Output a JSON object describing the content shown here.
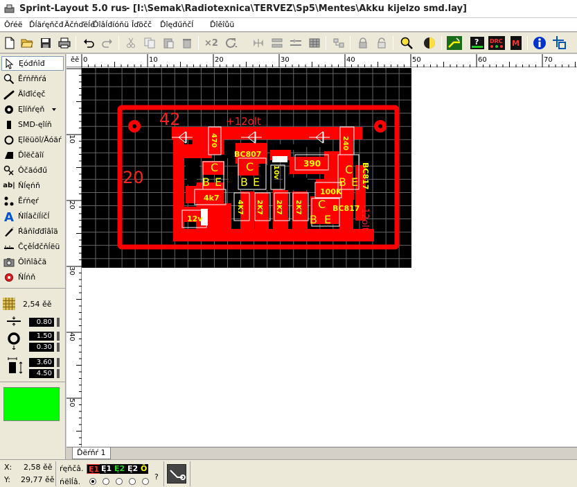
{
  "window": {
    "app_title": "Sprint-Layout 5.0 rus",
    "file_path": "- [I:\\Semak\\Radiotexnica\\TERVEZ\\Sp5\\Mentes\\Akku kijelzo smd.lay]"
  },
  "menu": [
    "Ôŕéë",
    "Ďĺäŕęňčđ",
    "Äčńďëĺé",
    "Ďîâĺđíóňü",
    "Îďöčč",
    "Ďîęđűňčĺ",
    "Ďîěîůü"
  ],
  "toolbar": {
    "icons": [
      "new-icon",
      "open-icon",
      "save-icon",
      "print-icon",
      "undo-icon",
      "redo-icon",
      "cut-icon",
      "copy-icon",
      "paste-icon",
      "delete-icon",
      "duplicate-x2-icon",
      "rotate-icon",
      "mirror-h-icon",
      "mirror-v-icon",
      "align-icon",
      "group-icon",
      "ungroup-icon",
      "lock-icon",
      "unlock-icon",
      "zoom-icon",
      "view-toggle-icon",
      "autorouter-icon",
      "help-components-icon",
      "drc-icon",
      "macro-icon",
      "info-icon",
      "crosshair-icon"
    ],
    "duplicate_label": "×2"
  },
  "tools": [
    {
      "label": "Ęóđńîđ",
      "icon": "cursor-icon"
    },
    {
      "label": "Ěŕńřňŕá",
      "icon": "zoom-tool-icon"
    },
    {
      "label": "Äîđîćęč",
      "icon": "track-icon"
    },
    {
      "label": "Ęîíňŕęň",
      "icon": "pad-icon"
    },
    {
      "label": "SMD-ęîíň",
      "icon": "smd-pad-icon"
    },
    {
      "label": "Ęîëüöî/Äóăŕ",
      "icon": "circle-icon"
    },
    {
      "label": "Ďîëčăîí",
      "icon": "polygon-icon"
    },
    {
      "label": "Ôčăóđű",
      "icon": "special-form-icon"
    },
    {
      "label": "Ňĺęńň",
      "icon": "text-icon"
    },
    {
      "label": "Ěŕńęŕ",
      "icon": "mask-icon"
    },
    {
      "label": "Ńîĺäčíĺíčĺ",
      "icon": "connection-icon"
    },
    {
      "label": "Ŕâňîďđîâîä",
      "icon": "autoroute-icon"
    },
    {
      "label": "Čçěĺđčňĺëü",
      "icon": "measure-icon"
    },
    {
      "label": "Ôîňîâčä",
      "icon": "photo-icon"
    },
    {
      "label": "Ňĺńň",
      "icon": "test-icon"
    }
  ],
  "grid_label": "2,54 ěě",
  "params": [
    "0.80",
    "1.50",
    "0.30",
    "3.60",
    "4.50"
  ],
  "swatch_color": "#00ff00",
  "ruler_top_label": "ěě",
  "ruler_top": [
    "0",
    "10",
    "20",
    "30",
    "40",
    "50",
    "60",
    "70"
  ],
  "ruler_left": [
    "10",
    "20",
    "30",
    "40",
    "50"
  ],
  "pcb_labels": {
    "l42": "42",
    "l20": "20",
    "plus12": "+12olt",
    "minus12": "-12olt",
    "bc807": "BC807",
    "bc817a": "BC817",
    "bc817b": "BC817",
    "r470": "470",
    "r240": "240",
    "r390": "390",
    "r100k": "100K",
    "r4k7a": "4k7",
    "r4k7b": "4K7",
    "r2k7a": "2K7",
    "r2k7b": "2K7",
    "r2k7c": "2K7",
    "v10": "10v",
    "v12": "12v",
    "c": "C",
    "b": "B",
    "e": "E"
  },
  "tab": "Ďëŕňŕ 1",
  "status": {
    "x_label": "X:",
    "x_value": "2,58 ěě",
    "y_label": "Y:",
    "y_value": "29,77 ěě",
    "layer_title": "ŕęňčâ.",
    "visible_title": "ńëîĺâ.",
    "layers": [
      "Ę1",
      "Ę1",
      "Ę2",
      "Ę2",
      "Ô"
    ],
    "help_mark": "?"
  }
}
